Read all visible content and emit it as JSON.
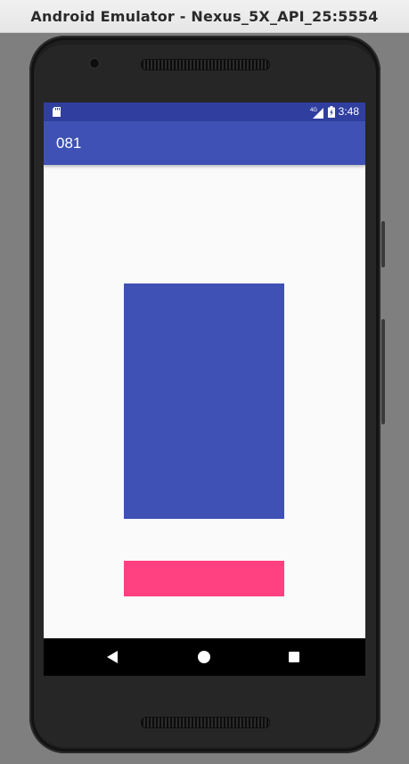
{
  "window": {
    "title": "Android Emulator - Nexus_5X_API_25:5554"
  },
  "status_bar": {
    "network_label": "4G",
    "time": "3:48",
    "icons": [
      "sd-card-icon",
      "signal-4g-icon",
      "battery-charging-icon"
    ]
  },
  "app_bar": {
    "title": "081"
  },
  "navigation_bar": {
    "icons": [
      "back-icon",
      "home-icon",
      "recents-icon"
    ]
  },
  "colors": {
    "status_bar": "#303f9f",
    "primary": "#3f51b5",
    "accent": "#ff4081",
    "screen_background": "#fafafa"
  }
}
